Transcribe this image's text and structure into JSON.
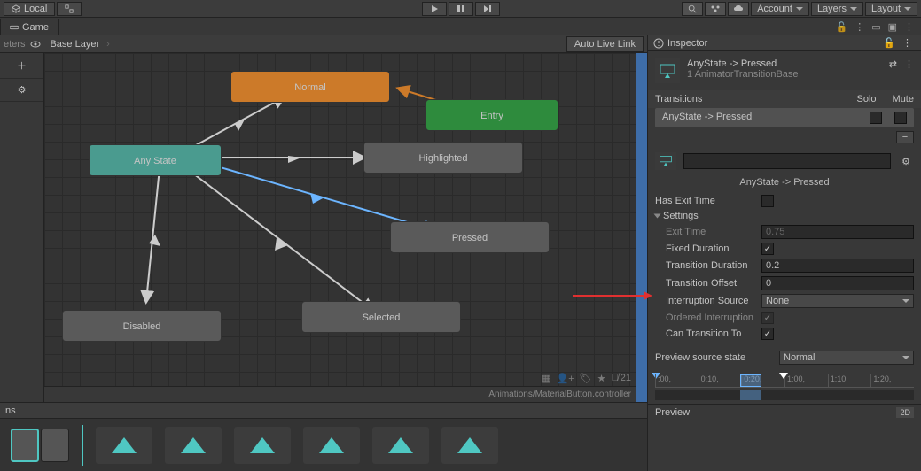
{
  "toolbar": {
    "local": "Local",
    "account": "Account",
    "layers": "Layers",
    "layout": "Layout"
  },
  "tabs": {
    "game": "Game",
    "inspector": "Inspector"
  },
  "animator": {
    "breadcrumb_left": "eters",
    "breadcrumb_base": "Base Layer",
    "auto_live_link": "Auto Live Link",
    "footer_path": "Animations/MaterialButton.controller",
    "visible_count": "21"
  },
  "nodes": {
    "normal": "Normal",
    "entry": "Entry",
    "any_state": "Any State",
    "highlighted": "Highlighted",
    "pressed": "Pressed",
    "selected": "Selected",
    "disabled": "Disabled"
  },
  "bottom": {
    "header": "ns"
  },
  "inspector": {
    "title": "AnyState -> Pressed",
    "subtitle": "1 AnimatorTransitionBase",
    "transitions_header": "Transitions",
    "solo": "Solo",
    "mute": "Mute",
    "transition_row": "AnyState -> Pressed",
    "name_display": "AnyState -> Pressed",
    "has_exit_time": "Has Exit Time",
    "settings": "Settings",
    "exit_time_label": "Exit Time",
    "exit_time_value": "0.75",
    "fixed_duration": "Fixed Duration",
    "transition_duration_label": "Transition Duration",
    "transition_duration_value": "0.2",
    "transition_offset_label": "Transition Offset",
    "transition_offset_value": "0",
    "interruption_source_label": "Interruption Source",
    "interruption_source_value": "None",
    "ordered_interruption": "Ordered Interruption",
    "can_transition_to": "Can Transition To",
    "preview_source_state_label": "Preview source state",
    "preview_source_state_value": "Normal",
    "timeline_ticks": [
      ":00,",
      "0:10,",
      "0:20,",
      "1:00,",
      "1:10,",
      "1:20,"
    ],
    "preview": "Preview",
    "twod": "2D"
  }
}
